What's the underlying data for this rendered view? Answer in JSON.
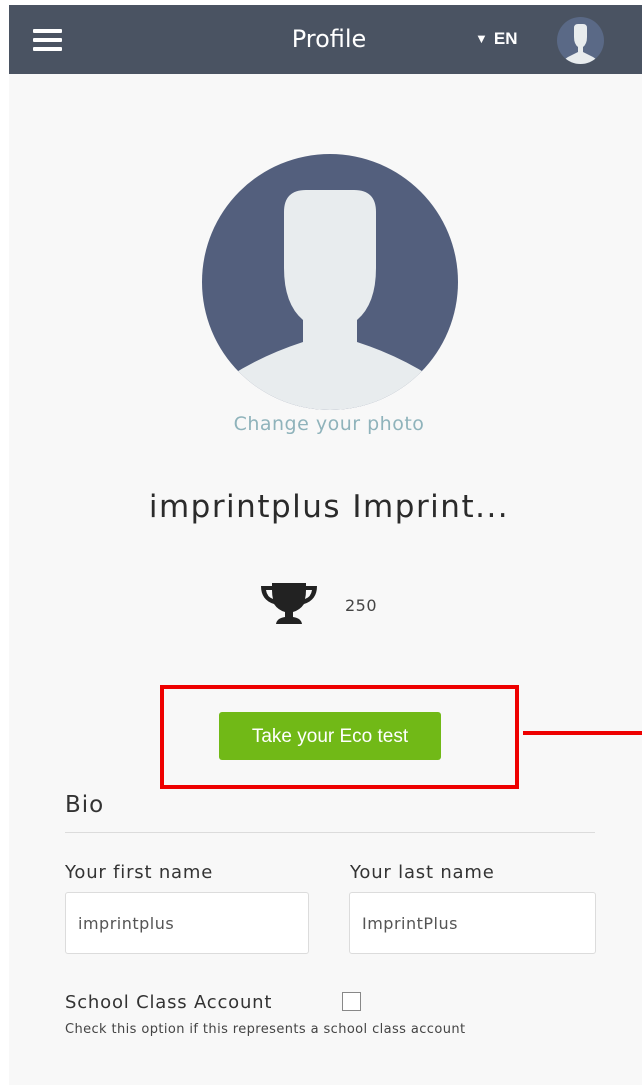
{
  "header": {
    "menu_icon": "hamburger-menu-icon",
    "title": "Profile",
    "language": "EN",
    "language_caret_icon": "caret-down-icon",
    "avatar_icon": "user-avatar-icon"
  },
  "profile": {
    "photo_icon": "user-silhouette-icon",
    "change_photo_label": "Change your photo",
    "display_name": "imprintplus Imprint...",
    "trophy_icon": "trophy-icon",
    "points": "250",
    "eco_test_button": "Take your Eco test"
  },
  "bio": {
    "section_title": "Bio",
    "first_name_label": "Your first name",
    "first_name_value": "imprintplus",
    "last_name_label": "Your last name",
    "last_name_value": "ImprintPlus",
    "school_class_label": "School Class Account",
    "school_class_checked": false,
    "school_class_help": "Check this option if this represents a school class account"
  },
  "colors": {
    "header_bg": "#4a5362",
    "avatar_bg": "#535f7d",
    "button_green": "#71b917",
    "highlight_red": "#ee0000",
    "link_teal": "#8fb3bb"
  }
}
